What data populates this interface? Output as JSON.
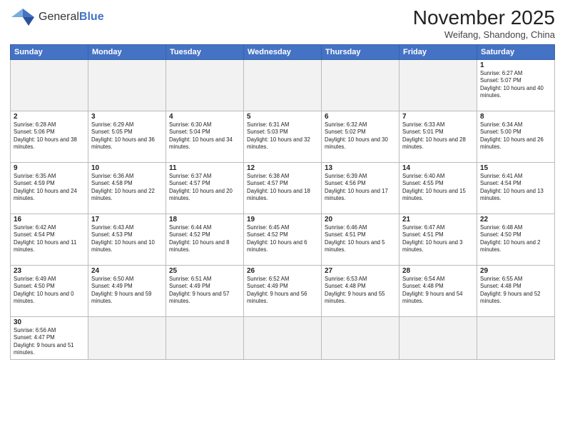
{
  "logo": {
    "text_general": "General",
    "text_blue": "Blue"
  },
  "title": "November 2025",
  "location": "Weifang, Shandong, China",
  "header_days": [
    "Sunday",
    "Monday",
    "Tuesday",
    "Wednesday",
    "Thursday",
    "Friday",
    "Saturday"
  ],
  "weeks": [
    [
      {
        "day": "",
        "info": ""
      },
      {
        "day": "",
        "info": ""
      },
      {
        "day": "",
        "info": ""
      },
      {
        "day": "",
        "info": ""
      },
      {
        "day": "",
        "info": ""
      },
      {
        "day": "",
        "info": ""
      },
      {
        "day": "1",
        "info": "Sunrise: 6:27 AM\nSunset: 5:07 PM\nDaylight: 10 hours and 40 minutes."
      }
    ],
    [
      {
        "day": "2",
        "info": "Sunrise: 6:28 AM\nSunset: 5:06 PM\nDaylight: 10 hours and 38 minutes."
      },
      {
        "day": "3",
        "info": "Sunrise: 6:29 AM\nSunset: 5:05 PM\nDaylight: 10 hours and 36 minutes."
      },
      {
        "day": "4",
        "info": "Sunrise: 6:30 AM\nSunset: 5:04 PM\nDaylight: 10 hours and 34 minutes."
      },
      {
        "day": "5",
        "info": "Sunrise: 6:31 AM\nSunset: 5:03 PM\nDaylight: 10 hours and 32 minutes."
      },
      {
        "day": "6",
        "info": "Sunrise: 6:32 AM\nSunset: 5:02 PM\nDaylight: 10 hours and 30 minutes."
      },
      {
        "day": "7",
        "info": "Sunrise: 6:33 AM\nSunset: 5:01 PM\nDaylight: 10 hours and 28 minutes."
      },
      {
        "day": "8",
        "info": "Sunrise: 6:34 AM\nSunset: 5:00 PM\nDaylight: 10 hours and 26 minutes."
      }
    ],
    [
      {
        "day": "9",
        "info": "Sunrise: 6:35 AM\nSunset: 4:59 PM\nDaylight: 10 hours and 24 minutes."
      },
      {
        "day": "10",
        "info": "Sunrise: 6:36 AM\nSunset: 4:58 PM\nDaylight: 10 hours and 22 minutes."
      },
      {
        "day": "11",
        "info": "Sunrise: 6:37 AM\nSunset: 4:57 PM\nDaylight: 10 hours and 20 minutes."
      },
      {
        "day": "12",
        "info": "Sunrise: 6:38 AM\nSunset: 4:57 PM\nDaylight: 10 hours and 18 minutes."
      },
      {
        "day": "13",
        "info": "Sunrise: 6:39 AM\nSunset: 4:56 PM\nDaylight: 10 hours and 17 minutes."
      },
      {
        "day": "14",
        "info": "Sunrise: 6:40 AM\nSunset: 4:55 PM\nDaylight: 10 hours and 15 minutes."
      },
      {
        "day": "15",
        "info": "Sunrise: 6:41 AM\nSunset: 4:54 PM\nDaylight: 10 hours and 13 minutes."
      }
    ],
    [
      {
        "day": "16",
        "info": "Sunrise: 6:42 AM\nSunset: 4:54 PM\nDaylight: 10 hours and 11 minutes."
      },
      {
        "day": "17",
        "info": "Sunrise: 6:43 AM\nSunset: 4:53 PM\nDaylight: 10 hours and 10 minutes."
      },
      {
        "day": "18",
        "info": "Sunrise: 6:44 AM\nSunset: 4:52 PM\nDaylight: 10 hours and 8 minutes."
      },
      {
        "day": "19",
        "info": "Sunrise: 6:45 AM\nSunset: 4:52 PM\nDaylight: 10 hours and 6 minutes."
      },
      {
        "day": "20",
        "info": "Sunrise: 6:46 AM\nSunset: 4:51 PM\nDaylight: 10 hours and 5 minutes."
      },
      {
        "day": "21",
        "info": "Sunrise: 6:47 AM\nSunset: 4:51 PM\nDaylight: 10 hours and 3 minutes."
      },
      {
        "day": "22",
        "info": "Sunrise: 6:48 AM\nSunset: 4:50 PM\nDaylight: 10 hours and 2 minutes."
      }
    ],
    [
      {
        "day": "23",
        "info": "Sunrise: 6:49 AM\nSunset: 4:50 PM\nDaylight: 10 hours and 0 minutes."
      },
      {
        "day": "24",
        "info": "Sunrise: 6:50 AM\nSunset: 4:49 PM\nDaylight: 9 hours and 59 minutes."
      },
      {
        "day": "25",
        "info": "Sunrise: 6:51 AM\nSunset: 4:49 PM\nDaylight: 9 hours and 57 minutes."
      },
      {
        "day": "26",
        "info": "Sunrise: 6:52 AM\nSunset: 4:49 PM\nDaylight: 9 hours and 56 minutes."
      },
      {
        "day": "27",
        "info": "Sunrise: 6:53 AM\nSunset: 4:48 PM\nDaylight: 9 hours and 55 minutes."
      },
      {
        "day": "28",
        "info": "Sunrise: 6:54 AM\nSunset: 4:48 PM\nDaylight: 9 hours and 54 minutes."
      },
      {
        "day": "29",
        "info": "Sunrise: 6:55 AM\nSunset: 4:48 PM\nDaylight: 9 hours and 52 minutes."
      }
    ],
    [
      {
        "day": "30",
        "info": "Sunrise: 6:56 AM\nSunset: 4:47 PM\nDaylight: 9 hours and 51 minutes."
      },
      {
        "day": "",
        "info": ""
      },
      {
        "day": "",
        "info": ""
      },
      {
        "day": "",
        "info": ""
      },
      {
        "day": "",
        "info": ""
      },
      {
        "day": "",
        "info": ""
      },
      {
        "day": "",
        "info": ""
      }
    ]
  ]
}
